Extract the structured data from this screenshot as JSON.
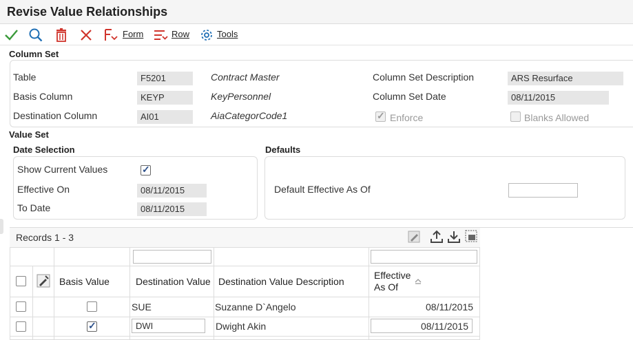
{
  "window": {
    "title": "Revise Value Relationships"
  },
  "toolbar": {
    "form_label": "Form",
    "row_label": "Row",
    "tools_label": "Tools"
  },
  "column_set": {
    "heading": "Column Set",
    "table_label": "Table",
    "table_value": "F5201",
    "table_desc": "Contract Master",
    "basis_label": "Basis Column",
    "basis_value": "KEYP",
    "basis_desc": "KeyPersonnel",
    "dest_label": "Destination Column",
    "dest_value": "AI01",
    "dest_desc": "AiaCategorCode1",
    "csd_label": "Column Set Description",
    "csd_value": "ARS Resurface",
    "csdate_label": "Column Set Date",
    "csdate_value": "08/11/2015",
    "enforce_label": "Enforce",
    "enforce_checked": true,
    "blanks_label": "Blanks Allowed",
    "blanks_checked": false
  },
  "value_set": {
    "heading": "Value Set",
    "date_selection": {
      "heading": "Date Selection",
      "show_current_label": "Show Current Values",
      "show_current_checked": true,
      "effective_on_label": "Effective On",
      "effective_on_value": "08/11/2015",
      "to_date_label": "To Date",
      "to_date_value": "08/11/2015"
    },
    "defaults": {
      "heading": "Defaults",
      "default_eff_label": "Default Effective As Of",
      "default_eff_value": ""
    }
  },
  "grid": {
    "records_label": "Records 1 - 3",
    "columns": {
      "basis_value": "Basis Value",
      "destination_value": "Destination Value",
      "destination_desc": "Destination Value Description",
      "effective_line1": "Effective",
      "effective_line2": "As Of"
    },
    "rows": [
      {
        "basis_checked": false,
        "destination_value": "SUE",
        "description": "Suzanne D`Angelo",
        "effective_as_of": "08/11/2015",
        "editable": false
      },
      {
        "basis_checked": true,
        "destination_value": "DWI",
        "description": "Dwight Akin",
        "effective_as_of": "08/11/2015",
        "editable": true
      }
    ]
  },
  "colors": {
    "accent_blue": "#1f6fb5",
    "check_green": "#3a9a3a",
    "delete_red": "#d0342c"
  }
}
